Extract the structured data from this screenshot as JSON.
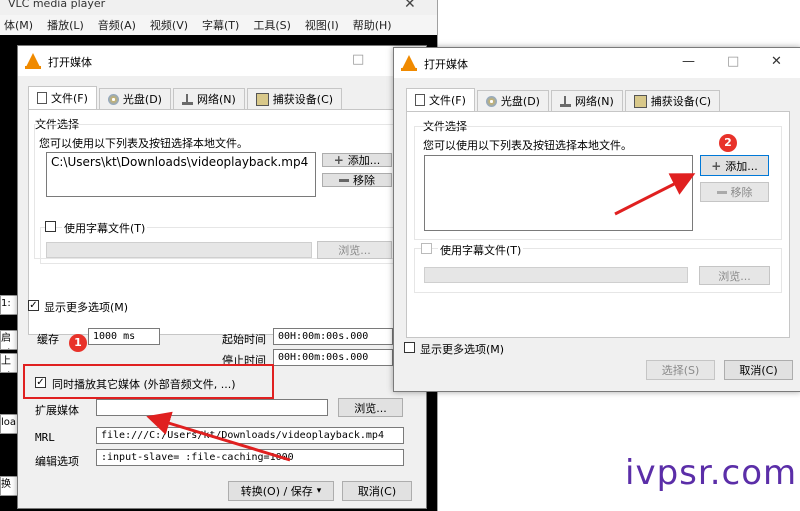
{
  "vlc_main": {
    "title": "VLC media player",
    "menu": [
      "体(M)",
      "播放(L)",
      "音频(A)",
      "视频(V)",
      "字幕(T)",
      "工具(S)",
      "视图(I)",
      "帮助(H)"
    ],
    "side_fragments": [
      "1:",
      "启吋",
      "上吋",
      "loa",
      "换"
    ]
  },
  "dialog_left": {
    "title": "打开媒体",
    "tabs": [
      {
        "label": "文件(F)",
        "icon": "file-icon"
      },
      {
        "label": "光盘(D)",
        "icon": "disc-icon"
      },
      {
        "label": "网络(N)",
        "icon": "network-icon"
      },
      {
        "label": "捕获设备(C)",
        "icon": "capture-icon"
      }
    ],
    "file_group_title": "文件选择",
    "file_hint": "您可以使用以下列表及按钮选择本地文件。",
    "file_list": [
      "C:\\Users\\kt\\Downloads\\videoplayback.mp4"
    ],
    "add_label": "添加...",
    "remove_label": "移除",
    "subtitle_label": "使用字幕文件(T)",
    "browse_label": "浏览...",
    "more_options_label": "显示更多选项(M)",
    "cache_label": "缓存",
    "cache_value": "1000 ms",
    "start_time_label": "起始时间",
    "start_time_value": "00H:00m:00s.000",
    "stop_time_label": "停止时间",
    "stop_time_value": "00H:00m:00s.000",
    "sync_play_label": "同时播放其它媒体 (外部音频文件, ...)",
    "extra_media_label": "扩展媒体",
    "extra_media_value": "",
    "extra_browse_label": "浏览...",
    "mrl_label": "MRL",
    "mrl_value": "file:///C:/Users/kt/Downloads/videoplayback.mp4",
    "edit_options_label": "编辑选项",
    "edit_options_value": ":input-slave= :file-caching=1000",
    "convert_label": "转换(O) / 保存",
    "cancel_label": "取消(C)"
  },
  "dialog_right": {
    "title": "打开媒体",
    "tabs": [
      {
        "label": "文件(F)",
        "icon": "file-icon"
      },
      {
        "label": "光盘(D)",
        "icon": "disc-icon"
      },
      {
        "label": "网络(N)",
        "icon": "network-icon"
      },
      {
        "label": "捕获设备(C)",
        "icon": "capture-icon"
      }
    ],
    "file_group_title": "文件选择",
    "file_hint": "您可以使用以下列表及按钮选择本地文件。",
    "add_label": "添加...",
    "remove_label": "移除",
    "subtitle_label": "使用字幕文件(T)",
    "browse_label": "浏览...",
    "more_options_label": "显示更多选项(M)",
    "select_label": "选择(S)",
    "cancel_label": "取消(C)"
  },
  "annotations": {
    "badge1": "1",
    "badge2": "2"
  },
  "watermark": "ivpsr.com",
  "colors": {
    "annotation_red": "#e02020",
    "vlc_orange": "#f08a00",
    "watermark": "#5b2ea8"
  }
}
